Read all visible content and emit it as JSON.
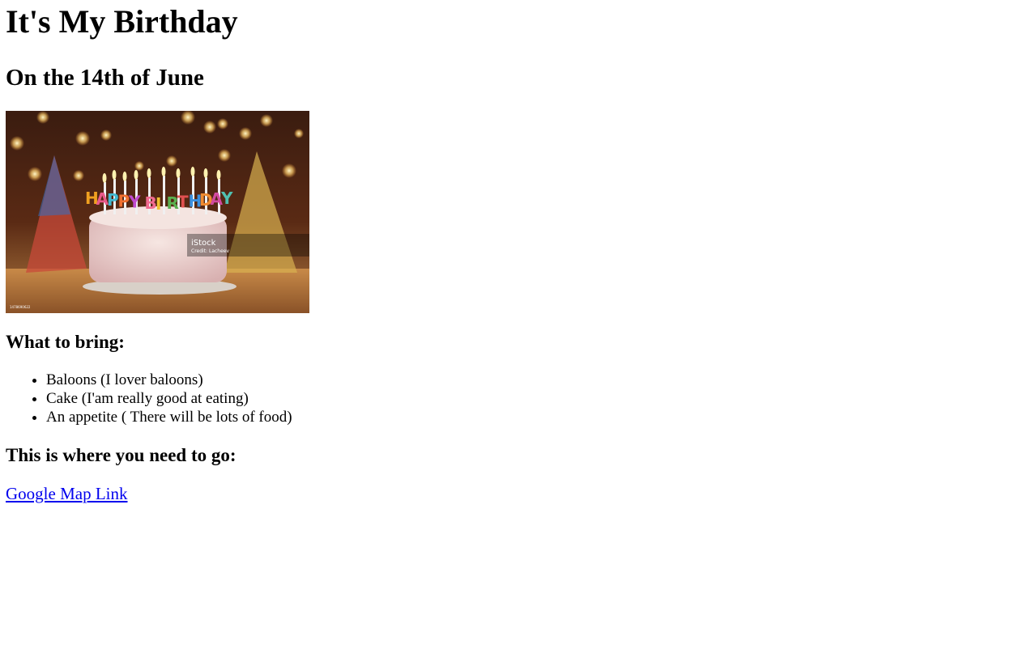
{
  "page": {
    "title": "It's My Birthday",
    "date_line": "On the 14th of June"
  },
  "photo": {
    "subject": "birthday cake with candles",
    "candle_letters": [
      "H",
      "A",
      "P",
      "P",
      "Y",
      "B",
      "I",
      "R",
      "T",
      "H",
      "D",
      "A",
      "Y"
    ],
    "watermark": "iStock",
    "credit": "Credit: Lacheev",
    "id_text": "1478690622"
  },
  "bring": {
    "title": "What to bring:",
    "items": [
      "Baloons (I lover baloons)",
      "Cake (I'am really good at eating)",
      "An appetite ( There will be lots of food)"
    ]
  },
  "go": {
    "title": "This is where you need to go:",
    "link_label": "Google Map Link"
  }
}
